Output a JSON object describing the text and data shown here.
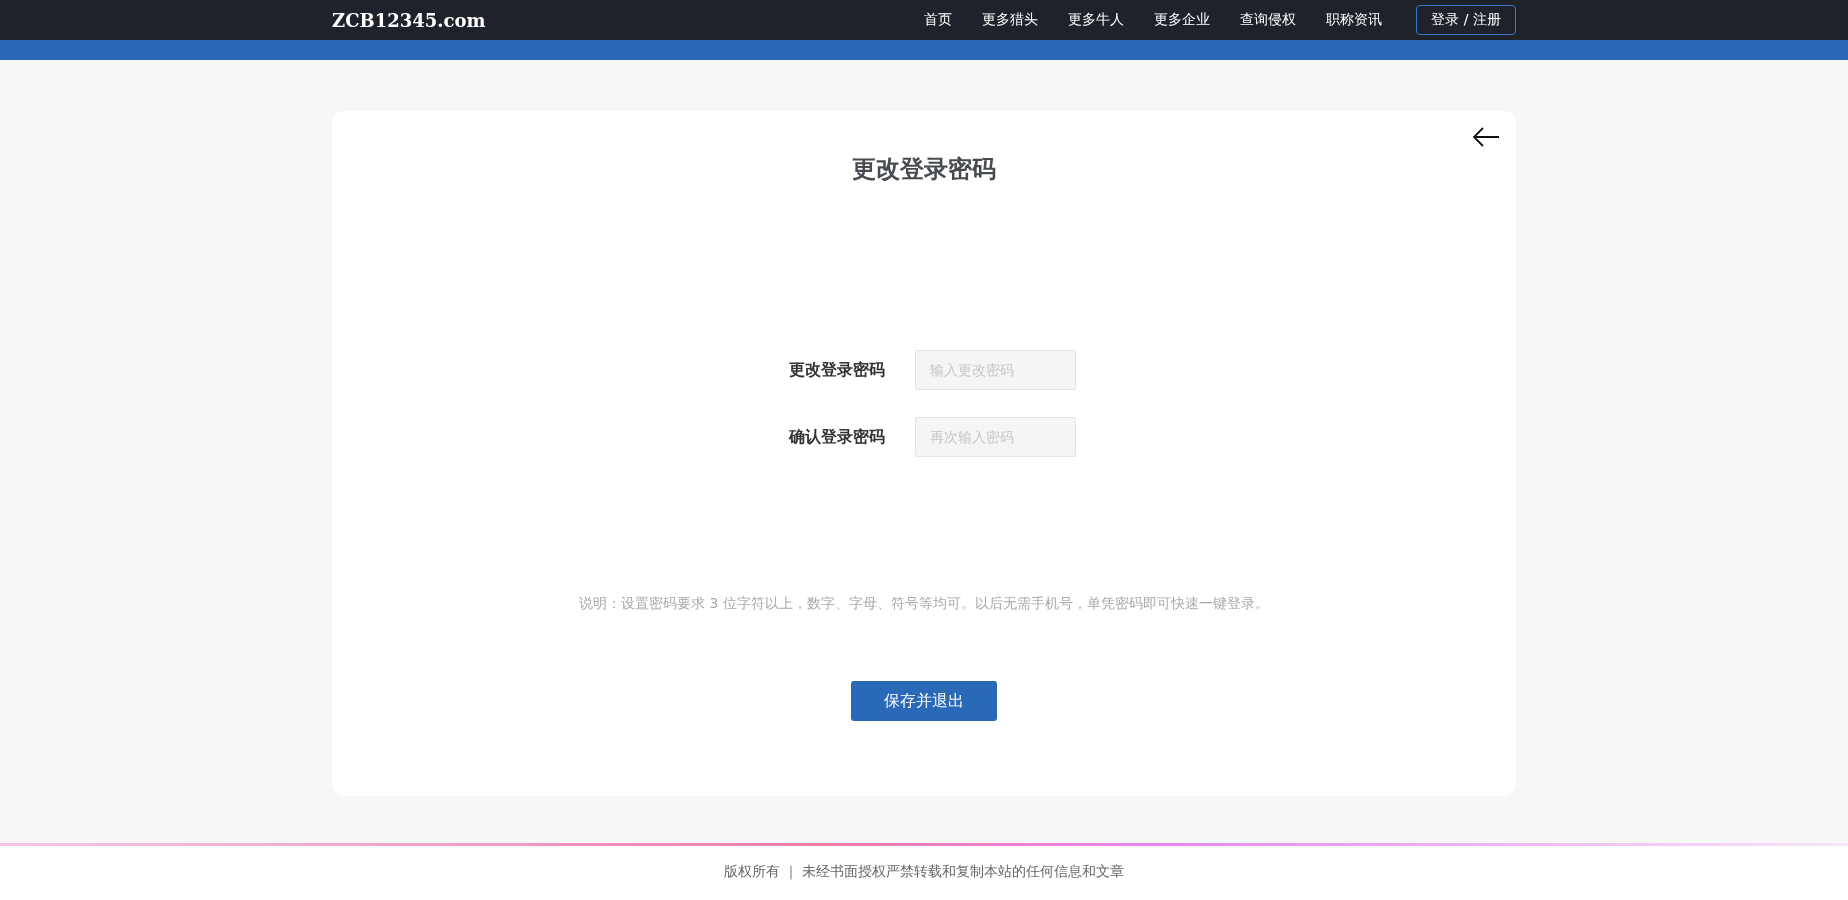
{
  "header": {
    "logo": "ZCB12345.com",
    "nav": [
      {
        "label": "首页"
      },
      {
        "label": "更多猎头"
      },
      {
        "label": "更多牛人"
      },
      {
        "label": "更多企业"
      },
      {
        "label": "查询侵权"
      },
      {
        "label": "职称资讯"
      }
    ],
    "login_button": "登录 / 注册"
  },
  "card": {
    "title": "更改登录密码",
    "fields": [
      {
        "label": "更改登录密码",
        "placeholder": "输入更改密码"
      },
      {
        "label": "确认登录密码",
        "placeholder": "再次输入密码"
      }
    ],
    "note": "说明：设置密码要求 3 位字符以上，数字、字母、符号等均可。以后无需手机号，单凭密码即可快速一键登录。",
    "save_button": "保存并退出"
  },
  "footer": {
    "text": "版权所有 ｜ 未经书面授权严禁转载和复制本站的任何信息和文章"
  }
}
